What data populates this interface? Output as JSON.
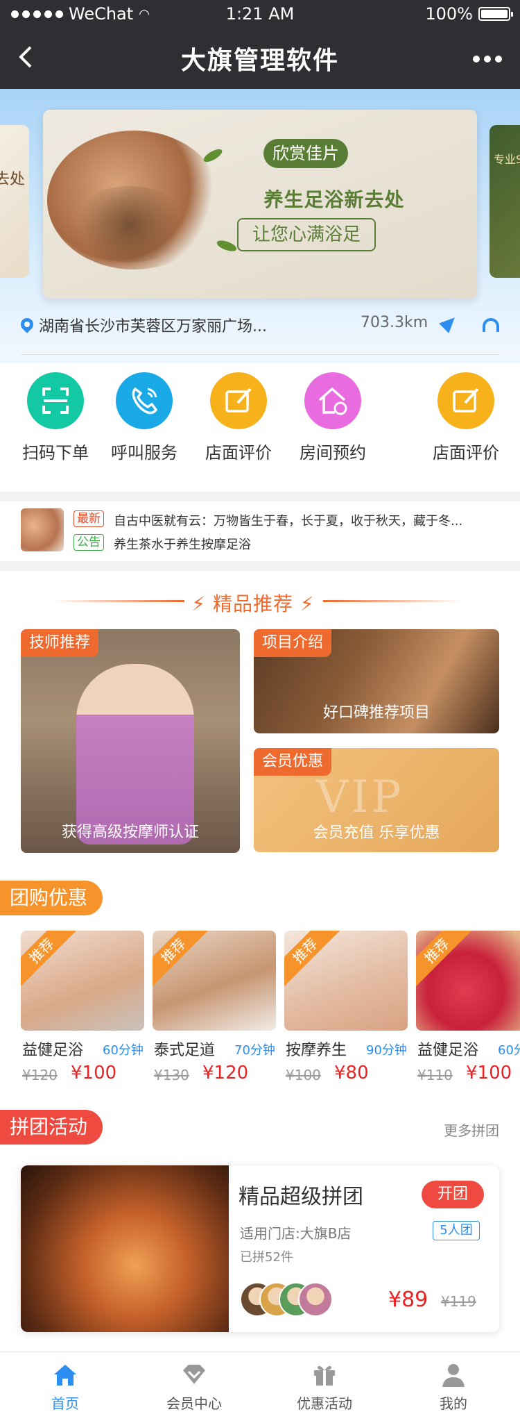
{
  "status_bar": {
    "carrier": "WeChat",
    "time": "1:21 AM",
    "battery": "100%"
  },
  "nav": {
    "title": "大旗管理软件"
  },
  "banner": {
    "pill": "欣赏佳片",
    "headline": "养生足浴新去处",
    "subline": "让您心满浴足",
    "left_peek": "去处",
    "right_peek": "专业S"
  },
  "location": {
    "address": "湖南省长沙市芙蓉区万家丽广场...",
    "distance": "703.3km"
  },
  "quick_actions": [
    {
      "label": "扫码下单",
      "icon": "scan-icon",
      "color": "#12c9a4"
    },
    {
      "label": "呼叫服务",
      "icon": "phone-icon",
      "color": "#18a9e6"
    },
    {
      "label": "店面评价",
      "icon": "edit-icon",
      "color": "#f7b21b"
    },
    {
      "label": "房间预约",
      "icon": "home-clock-icon",
      "color": "#e86be0"
    },
    {
      "label": "店面评价",
      "icon": "edit-icon",
      "color": "#f7b21b"
    }
  ],
  "notice": {
    "new_tag": "最新",
    "new_text": "自古中医就有云：万物皆生于春，长于夏，收于秋天，藏于冬...",
    "ad_tag": "公告",
    "ad_text": "养生茶水于养生按摩足浴"
  },
  "featured": {
    "section_title": "精品推荐",
    "left": {
      "badge": "技师推荐",
      "caption": "获得高级按摩师认证"
    },
    "top_right": {
      "badge": "项目介绍",
      "caption": "好口碑推荐项目"
    },
    "bottom_right": {
      "badge": "会员优惠",
      "watermark": "VIP",
      "caption": "会员充值   乐享优惠"
    }
  },
  "group_buy": {
    "title": "团购优惠",
    "ribbon": "推荐",
    "items": [
      {
        "name": "益健足浴",
        "duration": "60分钟",
        "old_price": "¥120",
        "price": "¥100"
      },
      {
        "name": "泰式足道",
        "duration": "70分钟",
        "old_price": "¥130",
        "price": "¥120"
      },
      {
        "name": "按摩养生",
        "duration": "90分钟",
        "old_price": "¥100",
        "price": "¥80"
      },
      {
        "name": "益健足浴",
        "duration": "60分",
        "old_price": "¥110",
        "price": "¥100"
      }
    ]
  },
  "pintuan": {
    "title": "拼团活动",
    "more": "更多拼团",
    "card": {
      "title": "精品超级拼团",
      "open_button": "开团",
      "store": "适用门店:大旗B店",
      "group_size": "5人团",
      "joined": "已拼52件",
      "price": "¥89",
      "old_price": "¥119"
    }
  },
  "tabbar": [
    {
      "label": "首页",
      "icon": "home-icon",
      "active": true
    },
    {
      "label": "会员中心",
      "icon": "diamond-icon",
      "active": false
    },
    {
      "label": "优惠活动",
      "icon": "gift-icon",
      "active": false
    },
    {
      "label": "我的",
      "icon": "user-icon",
      "active": false
    }
  ]
}
